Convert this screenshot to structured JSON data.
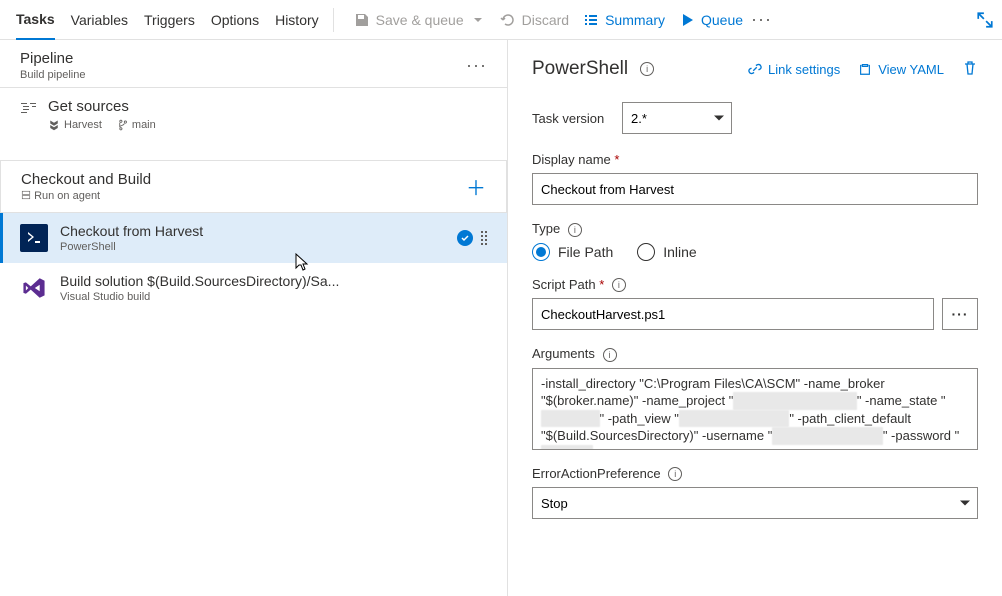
{
  "tabs": [
    {
      "label": "Tasks",
      "active": true
    },
    {
      "label": "Variables",
      "active": false
    },
    {
      "label": "Triggers",
      "active": false
    },
    {
      "label": "Options",
      "active": false
    },
    {
      "label": "History",
      "active": false
    }
  ],
  "toolbar": {
    "save_queue": "Save & queue",
    "discard": "Discard",
    "summary": "Summary",
    "queue": "Queue"
  },
  "pipeline": {
    "title": "Pipeline",
    "subtitle": "Build pipeline"
  },
  "sources": {
    "title": "Get sources",
    "repo_icon": "harvest",
    "repo": "Harvest",
    "branch": "main"
  },
  "job": {
    "title": "Checkout and Build",
    "subtitle": "Run on agent"
  },
  "tasks_list": [
    {
      "title": "Checkout from Harvest",
      "subtitle": "PowerShell",
      "icon": "ps",
      "selected": true
    },
    {
      "title": "Build solution $(Build.SourcesDirectory)/Sa...",
      "subtitle": "Visual Studio build",
      "icon": "vs",
      "selected": false
    }
  ],
  "detail": {
    "header": "PowerShell",
    "link_settings": "Link settings",
    "view_yaml": "View YAML",
    "task_version_label": "Task version",
    "task_version_value": "2.*",
    "display_name_label": "Display name",
    "display_name_value": "Checkout from Harvest",
    "type_label": "Type",
    "type_filepath": "File Path",
    "type_inline": "Inline",
    "type_selected": "File Path",
    "script_path_label": "Script Path",
    "script_path_value": "CheckoutHarvest.ps1",
    "arguments_label": "Arguments",
    "arguments_value": "-install_directory \"C:\\Program Files\\CA\\SCM\" -name_broker \"$(broker.name)\" -name_project \"[redacted]\" -name_state \"[redacted]\" -path_view \"[redacted]\" -path_client_default \"$(Build.SourcesDirectory)\" -username \"[redacted]\" -password \"[redacted]\"",
    "error_pref_label": "ErrorActionPreference",
    "error_pref_value": "Stop"
  }
}
